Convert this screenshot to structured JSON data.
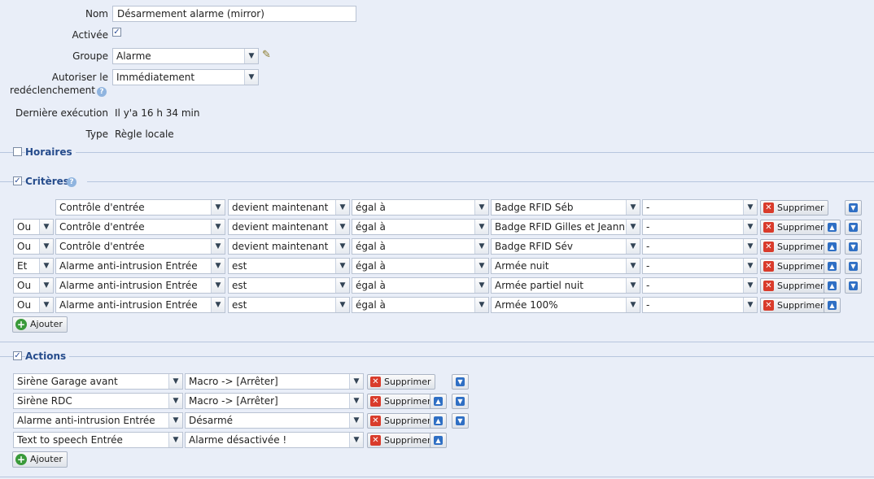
{
  "form": {
    "nom_label": "Nom",
    "nom_value": "Désarmement alarme (mirror)",
    "activee_label": "Activée",
    "groupe_label": "Groupe",
    "groupe_value": "Alarme",
    "autoriser_label_1": "Autoriser le",
    "autoriser_label_2": "redéclenchement",
    "autoriser_value": "Immédiatement",
    "derniere_label": "Dernière exécution",
    "derniere_value": "Il y'a 16 h 34 min",
    "type_label": "Type",
    "type_value": "Règle locale"
  },
  "sections": {
    "horaires": "Horaires",
    "criteres": "Critères",
    "actions": "Actions"
  },
  "buttons": {
    "supprimer": "Supprimer",
    "ajouter": "Ajouter"
  },
  "criteria": [
    {
      "op": "",
      "device": "Contrôle d'entrée",
      "event": "devient maintenant",
      "cmp": "égal à",
      "value": "Badge RFID Séb",
      "extra": "-"
    },
    {
      "op": "Ou",
      "device": "Contrôle d'entrée",
      "event": "devient maintenant",
      "cmp": "égal à",
      "value": "Badge RFID Gilles et Jeanne",
      "extra": "-"
    },
    {
      "op": "Ou",
      "device": "Contrôle d'entrée",
      "event": "devient maintenant",
      "cmp": "égal à",
      "value": "Badge RFID Sév",
      "extra": "-"
    },
    {
      "op": "Et",
      "device": "Alarme anti-intrusion Entrée",
      "event": "est",
      "cmp": "égal à",
      "value": "Armée nuit",
      "extra": "-"
    },
    {
      "op": "Ou",
      "device": "Alarme anti-intrusion Entrée",
      "event": "est",
      "cmp": "égal à",
      "value": "Armée partiel nuit",
      "extra": "-"
    },
    {
      "op": "Ou",
      "device": "Alarme anti-intrusion Entrée",
      "event": "est",
      "cmp": "égal à",
      "value": "Armée 100%",
      "extra": "-"
    }
  ],
  "actions": [
    {
      "device": "Sirène Garage avant",
      "action": "Macro -> [Arrêter]"
    },
    {
      "device": "Sirène RDC",
      "action": "Macro -> [Arrêter]"
    },
    {
      "device": "Alarme anti-intrusion Entrée",
      "action": "Désarmé"
    },
    {
      "device": "Text to speech Entrée",
      "action": "Alarme désactivée !"
    }
  ],
  "icons": {
    "dropdown": "chevron-down-icon",
    "check": "check-icon",
    "help": "help-icon",
    "edit": "pencil-icon",
    "delete": "delete-x-icon",
    "up": "arrow-up-icon",
    "down": "arrow-down-icon",
    "add": "plus-icon"
  }
}
